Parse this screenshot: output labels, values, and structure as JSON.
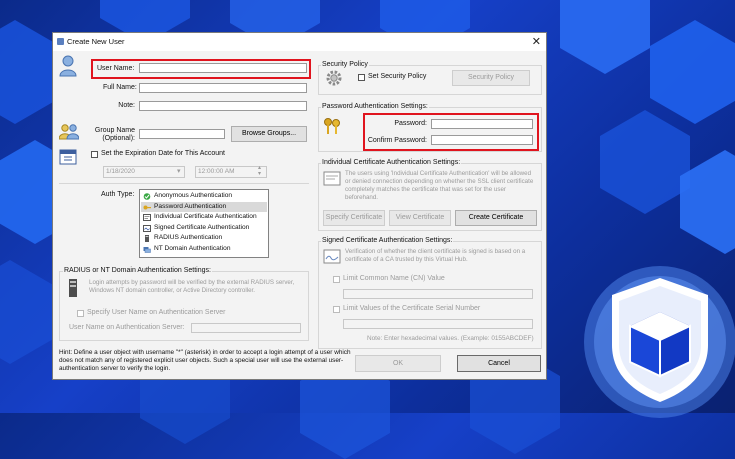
{
  "window": {
    "title": "Create New User",
    "close_glyph": "✕"
  },
  "user": {
    "user_name_label": "User Name:",
    "full_name_label": "Full Name:",
    "note_label": "Note:",
    "group_name_label_line1": "Group Name",
    "group_name_label_line2": "(Optional):",
    "browse_groups_label": "Browse Groups...",
    "expiration_label": "Set the Expiration Date for This Account",
    "expiration_date": "1/18/2020",
    "expiration_time": "12:00:00 AM"
  },
  "auth": {
    "label": "Auth Type:",
    "types": [
      {
        "label": "Anonymous Authentication",
        "icon": "check-shield-icon",
        "selected": false
      },
      {
        "label": "Password Authentication",
        "icon": "key-icon",
        "selected": true
      },
      {
        "label": "Individual Certificate Authentication",
        "icon": "certificate-icon",
        "selected": false
      },
      {
        "label": "Signed Certificate Authentication",
        "icon": "signed-certificate-icon",
        "selected": false
      },
      {
        "label": "RADIUS Authentication",
        "icon": "server-icon",
        "selected": false
      },
      {
        "label": "NT Domain Authentication",
        "icon": "domain-icon",
        "selected": false
      }
    ]
  },
  "radius": {
    "group_title": "RADIUS or NT Domain Authentication Settings:",
    "description": "Login attempts by password will be verified by the external RADIUS server, Windows NT domain controller, or Active Directory controller.",
    "specify_label": "Specify User Name on Authentication Server",
    "server_user_label": "User Name on Authentication Server:"
  },
  "hint": "Hint: Define a user object with username \"*\" (asterisk) in order to accept a login attempt of a user which does not match any of registered explicit user objects. Such a special user will use the external user-authentication server to verify the login.",
  "security_policy": {
    "group_title": "Security Policy",
    "checkbox_label": "Set Security Policy",
    "button_label": "Security Policy"
  },
  "password": {
    "group_title": "Password Authentication Settings:",
    "password_label": "Password:",
    "confirm_label": "Confirm Password:"
  },
  "individual_cert": {
    "group_title": "Individual Certificate Authentication Settings:",
    "description": "The users using 'Individual Certificate Authentication' will be allowed or denied connection depending on whether the SSL client certificate completely matches the certificate that was set for the user beforehand.",
    "specify_button": "Specify Certificate",
    "view_button": "View Certificate",
    "create_button": "Create Certificate"
  },
  "signed_cert": {
    "group_title": "Signed Certificate Authentication Settings:",
    "description": "Verification of whether the client certificate is signed is based on a certificate of a CA trusted by this Virtual Hub.",
    "limit_cn_label": "Limit Common Name (CN) Value",
    "limit_serial_label": "Limit Values of the Certificate Serial Number",
    "note": "Note: Enter hexadecimal values. (Example: 0155ABCDEF)"
  },
  "footer": {
    "ok_label": "OK",
    "cancel_label": "Cancel"
  },
  "colors": {
    "highlight": "#e0141e",
    "background": "#1640c8",
    "dialog": "#f3f3f3"
  }
}
